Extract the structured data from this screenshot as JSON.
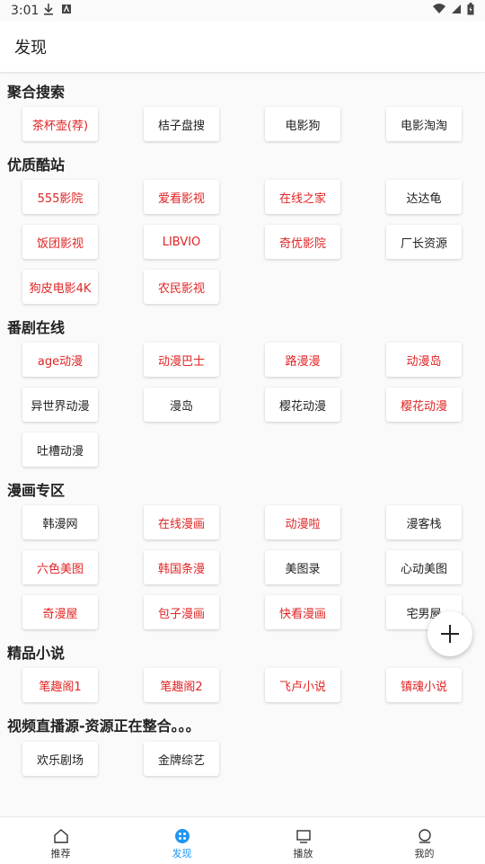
{
  "status": {
    "time": "3:01"
  },
  "appbar": {
    "title": "发现"
  },
  "sections": [
    {
      "title": "聚合搜索",
      "items": [
        {
          "label": "茶杯壶(荐)",
          "highlight": true
        },
        {
          "label": "桔子盘搜",
          "highlight": false
        },
        {
          "label": "电影狗",
          "highlight": false
        },
        {
          "label": "电影淘淘",
          "highlight": false
        }
      ]
    },
    {
      "title": "优质酷站",
      "items": [
        {
          "label": "555影院",
          "highlight": true
        },
        {
          "label": "爱看影视",
          "highlight": true
        },
        {
          "label": "在线之家",
          "highlight": true
        },
        {
          "label": "达达龟",
          "highlight": false
        },
        {
          "label": "饭团影视",
          "highlight": true
        },
        {
          "label": "LIBVIO",
          "highlight": true
        },
        {
          "label": "奇优影院",
          "highlight": true
        },
        {
          "label": "厂长资源",
          "highlight": false
        },
        {
          "label": "狗皮电影4K",
          "highlight": true
        },
        {
          "label": "农民影视",
          "highlight": true
        }
      ]
    },
    {
      "title": "番剧在线",
      "items": [
        {
          "label": "age动漫",
          "highlight": true
        },
        {
          "label": "动漫巴士",
          "highlight": true
        },
        {
          "label": "路漫漫",
          "highlight": true
        },
        {
          "label": "动漫岛",
          "highlight": true
        },
        {
          "label": "异世界动漫",
          "highlight": false
        },
        {
          "label": "漫岛",
          "highlight": false
        },
        {
          "label": "樱花动漫",
          "highlight": false
        },
        {
          "label": "樱花动漫",
          "highlight": true
        },
        {
          "label": "吐槽动漫",
          "highlight": false
        }
      ]
    },
    {
      "title": "漫画专区",
      "items": [
        {
          "label": "韩漫网",
          "highlight": false
        },
        {
          "label": "在线漫画",
          "highlight": true
        },
        {
          "label": "动漫啦",
          "highlight": true
        },
        {
          "label": "漫客栈",
          "highlight": false
        },
        {
          "label": "六色美图",
          "highlight": true
        },
        {
          "label": "韩国条漫",
          "highlight": true
        },
        {
          "label": "美图录",
          "highlight": false
        },
        {
          "label": "心动美图",
          "highlight": false
        },
        {
          "label": "奇漫屋",
          "highlight": true
        },
        {
          "label": "包子漫画",
          "highlight": true
        },
        {
          "label": "快看漫画",
          "highlight": true
        },
        {
          "label": "宅男屋",
          "highlight": false
        }
      ]
    },
    {
      "title": "精品小说",
      "items": [
        {
          "label": "笔趣阁1",
          "highlight": true
        },
        {
          "label": "笔趣阁2",
          "highlight": true
        },
        {
          "label": "飞卢小说",
          "highlight": true
        },
        {
          "label": "镇魂小说",
          "highlight": true
        }
      ]
    },
    {
      "title": "视频直播源-资源正在整合。。。",
      "items": [
        {
          "label": "欢乐剧场",
          "highlight": false
        },
        {
          "label": "金牌综艺",
          "highlight": false
        }
      ]
    }
  ],
  "nav": [
    {
      "label": "推荐",
      "icon": "home-icon",
      "active": false
    },
    {
      "label": "发现",
      "icon": "discover-icon",
      "active": true
    },
    {
      "label": "播放",
      "icon": "play-screen-icon",
      "active": false
    },
    {
      "label": "我的",
      "icon": "profile-icon",
      "active": false
    }
  ],
  "colors": {
    "highlight": "#e02424",
    "accent": "#2196f3"
  },
  "fab": {
    "icon": "plus-icon"
  }
}
